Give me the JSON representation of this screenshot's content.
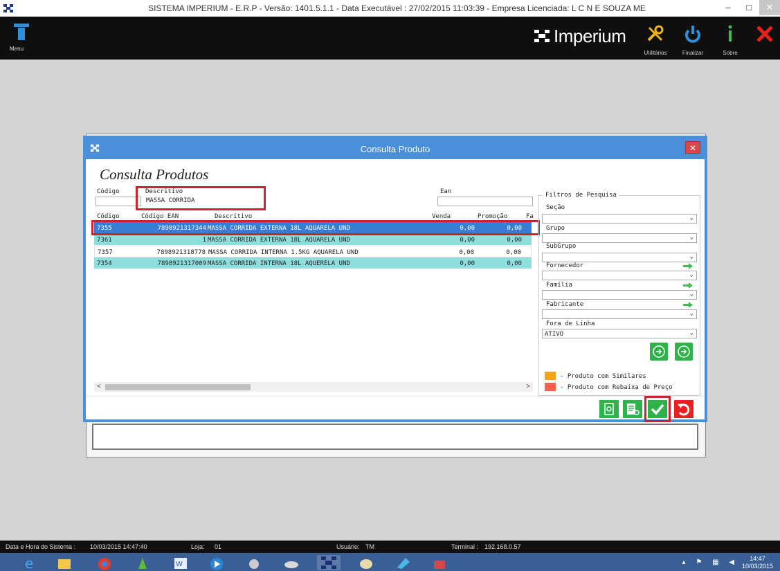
{
  "window": {
    "title": "SISTEMA IMPERIUM - E.R.P - Versão: 1401.5.1.1 - Data Executável : 27/02/2015 11:03:39 - Empresa Licenciada: L C N E SOUZA ME",
    "minimize": "–",
    "maximize": "□",
    "close": "✕"
  },
  "appbar": {
    "menu_label": "Menu",
    "brand": "Imperium",
    "tools": [
      {
        "label": "Utilitários",
        "icon": "tools-icon"
      },
      {
        "label": "Finalizar",
        "icon": "power-icon"
      },
      {
        "label": "Sobre",
        "icon": "info-icon"
      },
      {
        "label": "",
        "icon": "close-x-icon"
      }
    ]
  },
  "dialog": {
    "title": "Consulta Produto",
    "close": "✕",
    "heading": "Consulta Produtos",
    "search": {
      "codigo_label": "Código",
      "codigo_value": "",
      "descritivo_label": "Descritivo",
      "descritivo_value": "MASSA CORRIDA",
      "ean_label": "Ean",
      "ean_value": ""
    },
    "table": {
      "columns": [
        "Código",
        "Código EAN",
        "Descritivo",
        "Venda",
        "Promoção",
        "Fa"
      ],
      "rows": [
        {
          "codigo": "7355",
          "ean": "7898921317344",
          "descritivo": "MASSA CORRIDA EXTERNA 18L AQUARELA UND",
          "venda": "0,00",
          "promocao": "0,00"
        },
        {
          "codigo": "7361",
          "ean": "1",
          "descritivo": "MASSA CORRIDA EXTERNA 18L AQUARELA UND",
          "venda": "0,00",
          "promocao": "0,00"
        },
        {
          "codigo": "7357",
          "ean": "7898921318778",
          "descritivo": "MASSA CORRIDA INTERNA 1.5KG AQUARELA UND",
          "venda": "0,00",
          "promocao": "0,00"
        },
        {
          "codigo": "7354",
          "ean": "7898921317009",
          "descritivo": "MASSA CORRIDA INTERNA 18L AQUERELA UND",
          "venda": "0,00",
          "promocao": "0,00"
        }
      ]
    },
    "filters": {
      "title": "Filtros de Pesquisa",
      "secao": "Seção",
      "grupo": "Grupo",
      "subgrupo": "SubGrupo",
      "fornecedor": "Fornecedor",
      "familia": "Família",
      "fabricante": "Fabricante",
      "fora_de_linha": "Fora de Linha",
      "fora_de_linha_value": "ATIVO"
    },
    "legend": {
      "similares": "- Produto com Similares",
      "rebaixa": "- Produto com Rebaixa de Preço",
      "similares_color": "#f5a21b",
      "rebaixa_color": "#f0624a"
    }
  },
  "status": {
    "datetime_label": "Data e Hora do Sistema :",
    "datetime_value": "10/03/2015 14:47:40",
    "loja_label": "Loja:",
    "loja_value": "01",
    "usuario_label": "Usuário:",
    "usuario_value": "TM",
    "terminal_label": "Terminal :",
    "terminal_value": "192.168.0.57"
  },
  "taskbar": {
    "time": "14:47",
    "date": "10/03/2015"
  }
}
